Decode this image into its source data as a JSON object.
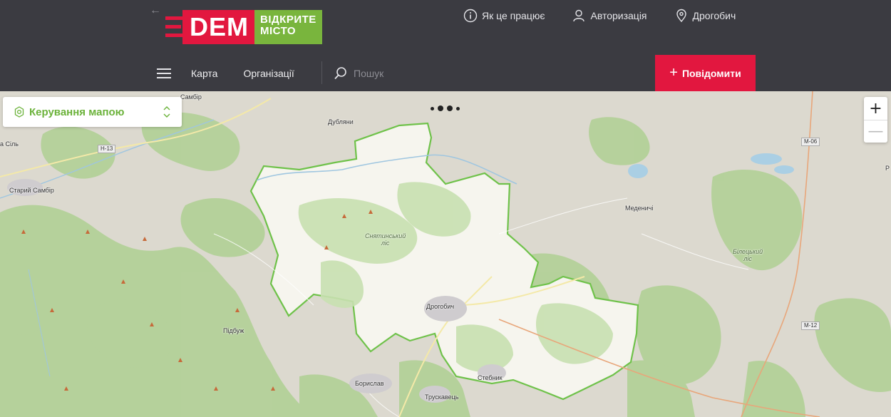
{
  "header": {
    "back_icon": "arrow-left-icon",
    "logo": {
      "brand": "DEM",
      "line1": "ВІДКРИТЕ",
      "line2": "МІСТО"
    },
    "top_links": [
      {
        "icon": "info-icon",
        "label": "Як це працює"
      },
      {
        "icon": "user-icon",
        "label": "Авторизація"
      },
      {
        "icon": "location-pin-icon",
        "label": "Дрогобич"
      }
    ],
    "nav": {
      "menu_icon": "burger-menu-icon",
      "links": [
        "Карта",
        "Організації"
      ]
    },
    "search": {
      "icon": "search-icon",
      "placeholder": "Пошук"
    },
    "report_button": {
      "icon": "plus-icon",
      "label": "Повідомити"
    }
  },
  "map": {
    "control": {
      "icon": "gear-icon",
      "label": "Керування мапою",
      "toggle_icon": "chevron-updown-icon"
    },
    "zoom": {
      "in": "+",
      "out": "—"
    },
    "labels": {
      "sambir_top": "Самбір",
      "stara_sil": "а Сіль",
      "staryi_sambir": "Старий Самбір",
      "dublyany": "Дубляни",
      "medenychi": "Меденичі",
      "drohobych": "Дрогобич",
      "pidbuzh": "Підбуж",
      "boryslav": "Борислав",
      "truskavets": "Трускавець",
      "stebnyk": "Стебник",
      "right_edge": "Р",
      "snyatynskyi_forest_1": "Снятинський",
      "snyatynskyi_forest_2": "ліс",
      "biletskyi_forest_1": "Білецький",
      "biletskyi_forest_2": "ліс"
    },
    "roads": {
      "h13": "Н-13",
      "m06": "М-06",
      "m12": "М-12"
    },
    "colors": {
      "boundary": "#6fc24a",
      "region_fill": "#f7f7f0",
      "forest": "#b4d39a",
      "accent": "#e2173f",
      "brand_green": "#79b53d"
    }
  }
}
